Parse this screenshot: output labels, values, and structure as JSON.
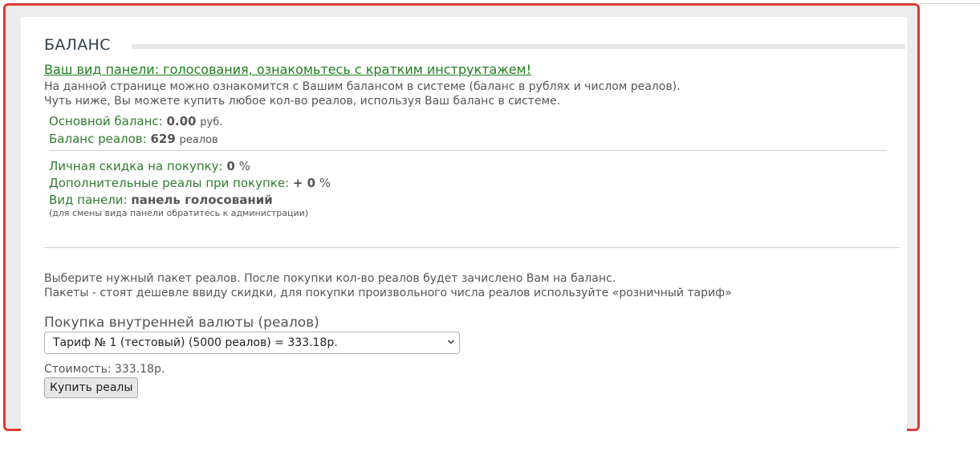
{
  "section": {
    "title": "БАЛАНС",
    "panel_link": "Ваш вид панели: голосования, ознакомьтесь с кратким инструктажем!",
    "intro_line_1": "На данной странице можно ознакомится с Вашим балансом в системе (баланс в рублях и числом реалов).",
    "intro_line_2": "Чуть ниже, Вы можете купить любое кол-во реалов, используя Ваш баланс в системе."
  },
  "balance": {
    "main_label": "Основной баланс: ",
    "main_value": "0.00",
    "main_unit": "руб.",
    "reals_label": "Баланс реалов: ",
    "reals_value": "629",
    "reals_unit": "реалов"
  },
  "discounts": {
    "personal_label": "Личная скидка на покупку: ",
    "personal_value": "0",
    "personal_unit": "%",
    "extra_label": "Дополнительные реалы при покупке: ",
    "extra_value": "+ 0",
    "extra_unit": "%",
    "panel_type_label": "Вид панели: ",
    "panel_type_value": "панель голосований",
    "panel_note": "(для смены вида панели обратитесь к администрации)"
  },
  "purchase": {
    "info_line_1": "Выберите нужный пакет реалов. После покупки кол-во реалов будет зачислено Вам на баланс.",
    "info_line_2": "Пакеты - стоят дешевле ввиду скидки, для покупки произвольного числа реалов используйте «розничный тариф»",
    "title": "Покупка внутренней валюты (реалов)",
    "selected_tariff": "Тариф № 1 (тестовый) (5000 реалов) = 333.18р.",
    "cost": "Стоимость: 333.18р.",
    "buy_label": "Купить реалы"
  },
  "colors": {
    "frame_border": "#dd3a34",
    "label_green": "#2e7d2e",
    "link_green": "#1d7f1d"
  },
  "icons": {
    "select_arrow": "chevron-down-icon"
  }
}
